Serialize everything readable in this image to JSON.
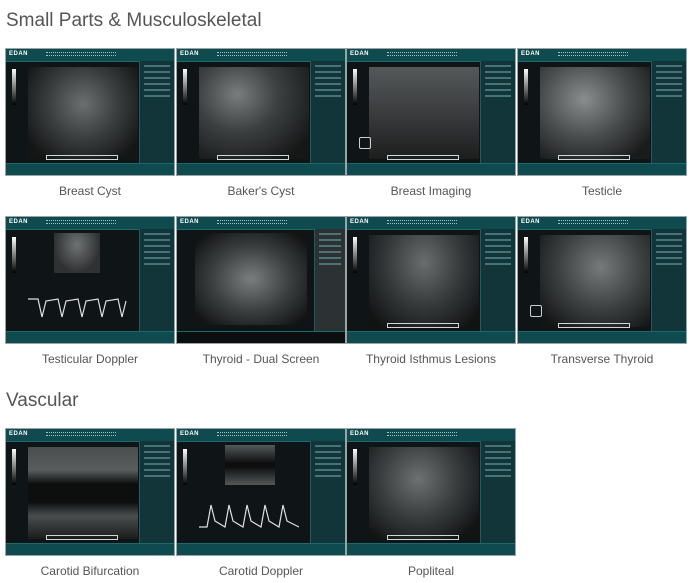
{
  "sections": [
    {
      "title": "Small Parts & Musculoskeletal",
      "items": [
        {
          "caption": "Breast Cyst"
        },
        {
          "caption": "Baker's Cyst"
        },
        {
          "caption": "Breast Imaging"
        },
        {
          "caption": "Testicle"
        },
        {
          "caption": "Testicular Doppler"
        },
        {
          "caption": "Thyroid - Dual Screen"
        },
        {
          "caption": "Thyroid Isthmus Lesions"
        },
        {
          "caption": "Transverse Thyroid"
        }
      ]
    },
    {
      "title": "Vascular",
      "items": [
        {
          "caption": "Carotid Bifurcation"
        },
        {
          "caption": "Carotid Doppler"
        },
        {
          "caption": "Popliteal"
        }
      ]
    }
  ],
  "brand_logo": "EDAN",
  "colors": {
    "ui_bar": "#0f4a4e",
    "scan_background": "#0f1416",
    "text": "#555555"
  }
}
